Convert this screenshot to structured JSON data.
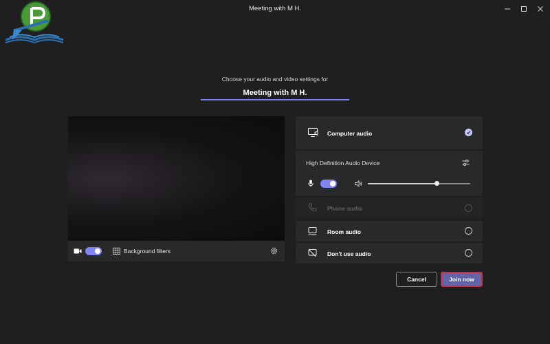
{
  "window": {
    "title": "Meeting with M H.",
    "controls": [
      "minimize",
      "maximize",
      "close"
    ]
  },
  "header": {
    "prompt": "Choose your audio and video settings for",
    "meeting_name": "Meeting with M H."
  },
  "video": {
    "camera_on": true,
    "background_filters_label": "Background filters"
  },
  "audio": {
    "options": [
      {
        "label": "Computer audio",
        "icon": "monitor-speaker-icon",
        "selected": true,
        "enabled": true
      },
      {
        "label": "Phone audio",
        "icon": "phone-icon",
        "selected": false,
        "enabled": false
      },
      {
        "label": "Room audio",
        "icon": "room-display-icon",
        "selected": false,
        "enabled": true
      },
      {
        "label": "Don't use audio",
        "icon": "no-audio-icon",
        "selected": false,
        "enabled": true
      }
    ],
    "device_name": "High Definition Audio Device",
    "mic_on": true,
    "speaker_volume": 0.67
  },
  "actions": {
    "cancel_label": "Cancel",
    "join_label": "Join now"
  },
  "colors": {
    "accent": "#7f85f5",
    "join_button": "#6264a7",
    "join_highlight": "#c0334f",
    "background": "#1f1f1f",
    "panel": "#292929"
  }
}
